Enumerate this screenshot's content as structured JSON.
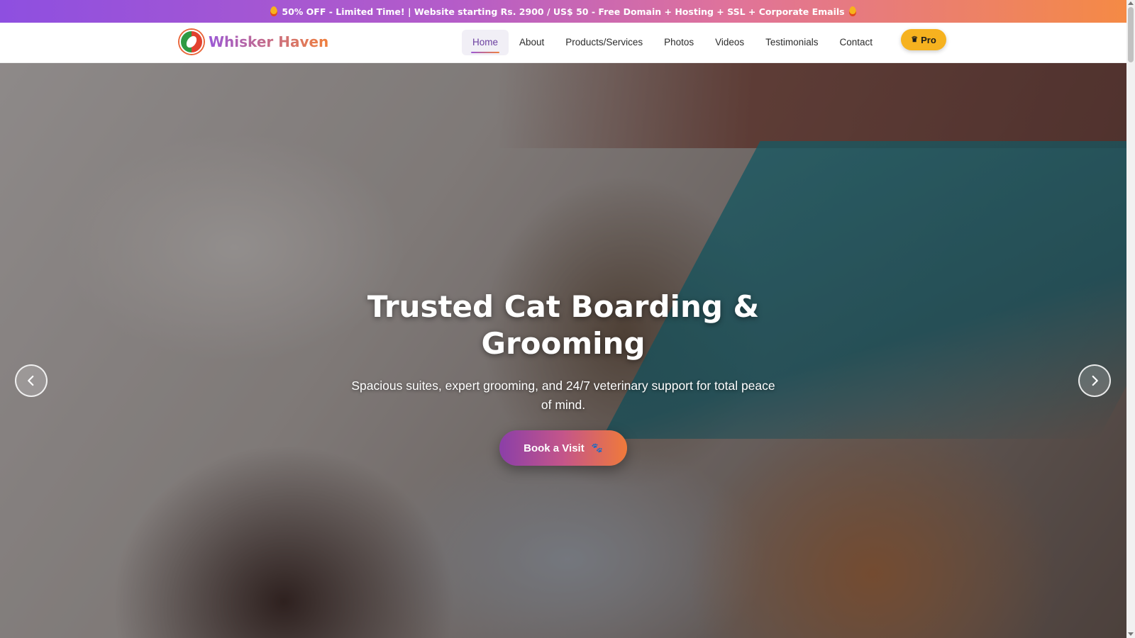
{
  "promo": {
    "text": "50% OFF - Limited Time! | Website starting Rs. 2900 / US$ 50 - Free Domain + Hosting + SSL + Corporate Emails",
    "icon": "flame-icon"
  },
  "brand": {
    "name": "Whisker Haven",
    "logo_icon": "whisker-haven-logo"
  },
  "nav": {
    "items": [
      {
        "label": "Home",
        "active": true
      },
      {
        "label": "About"
      },
      {
        "label": "Products/Services"
      },
      {
        "label": "Photos"
      },
      {
        "label": "Videos"
      },
      {
        "label": "Testimonials"
      },
      {
        "label": "Contact"
      }
    ],
    "pro_label": "Pro",
    "pro_icon": "crown-icon"
  },
  "hero": {
    "title": "Trusted Cat Boarding & Grooming",
    "subtitle": "Spacious suites, expert grooming, and 24/7 veterinary support for total peace of mind.",
    "cta_label": "Book a Visit",
    "cta_icon": "paw-icon",
    "prev_icon": "chevron-left-icon",
    "next_icon": "chevron-right-icon"
  },
  "colors": {
    "promo_start": "#8e4fe0",
    "promo_end": "#f58a45",
    "accent_purple": "#9b59d6",
    "accent_orange": "#f0803c",
    "pro_yellow": "#f6b21f"
  }
}
